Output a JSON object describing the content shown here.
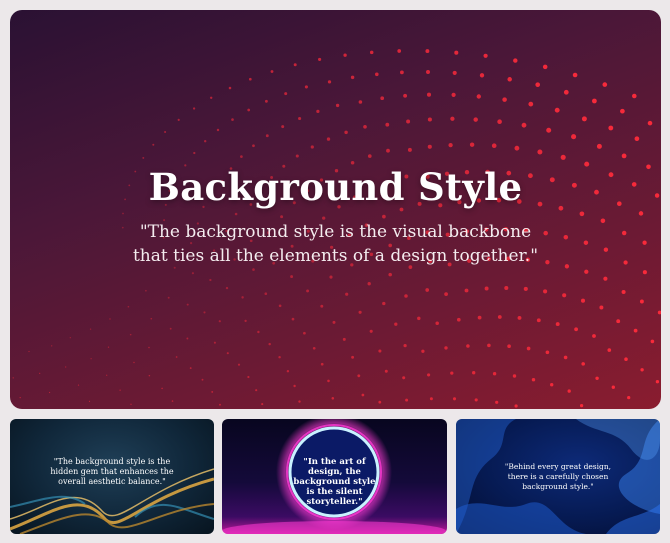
{
  "main_slide": {
    "title": "Background Style",
    "quote": "\"The background style is the visual backbone that ties all the elements of a design together.\"",
    "dot_color": "#ff2b3b"
  },
  "thumbnails": [
    {
      "quote": "\"The background style is the hidden gem that enhances the overall aesthetic balance.\"",
      "accent": "#d9a441"
    },
    {
      "quote": "\"In the art of design, the background style is the silent storyteller.\"",
      "accent": "#ff3bd4"
    },
    {
      "quote": "\"Behind every great design, there is a carefully chosen background style.\"",
      "accent": "#2f7bff"
    }
  ]
}
